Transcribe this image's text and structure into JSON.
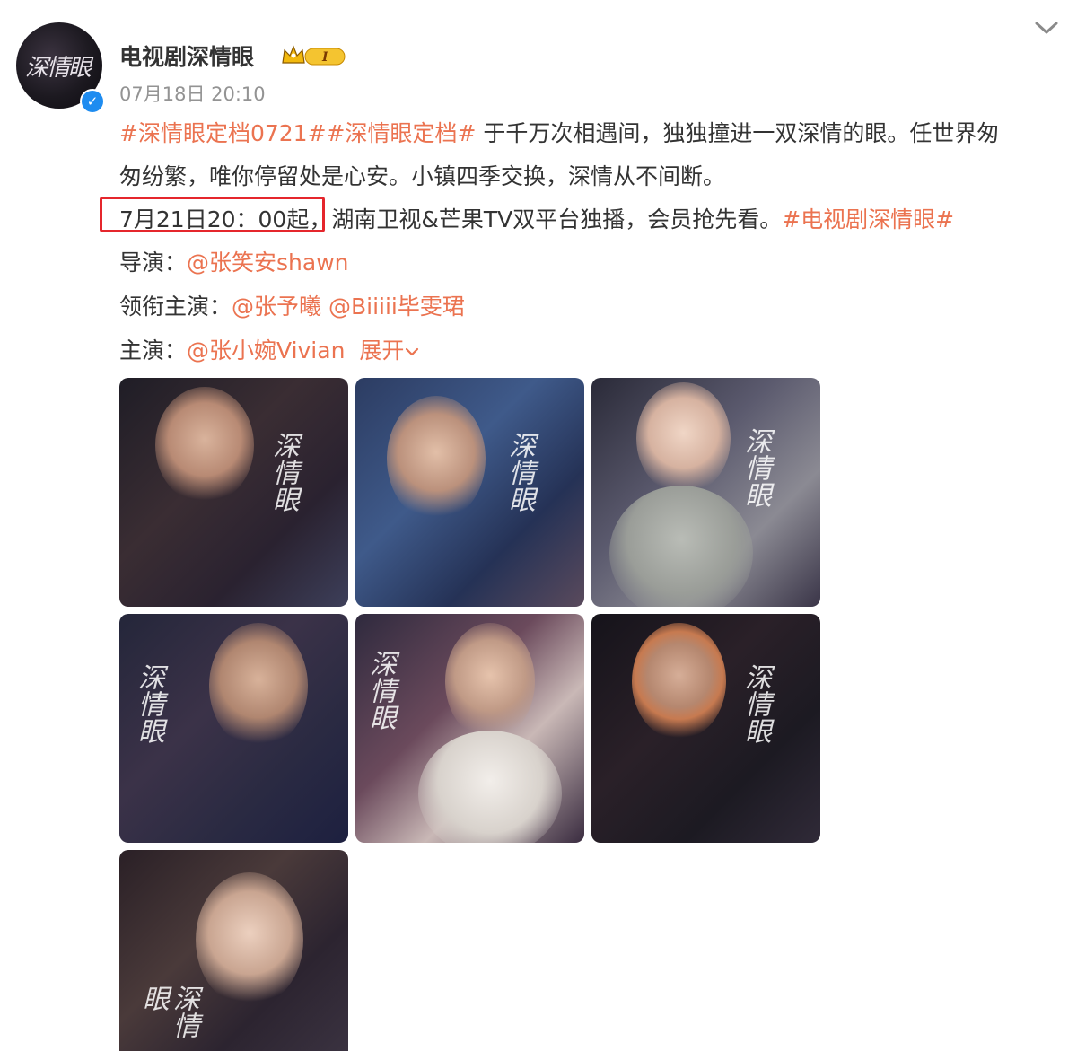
{
  "post": {
    "username": "电视剧深情眼",
    "avatar_text": "深情眼",
    "badge_text": "I",
    "timestamp": "07月18日 20:10",
    "lines": {
      "line1": {
        "tag1": "#深情眼定档0721#",
        "tag2": "#深情眼定档#",
        "text": " 于千万次相遇间，独独撞进一双深情的眼。任世界匆"
      },
      "line2": {
        "text": "匆纷繁，唯你停留处是心安。小镇四季交换，深情从不间断。"
      },
      "line3": {
        "text": "7月21日20：00起，湖南卫视&芒果TV双平台独播，会员抢先看。",
        "tag": "#电视剧深情眼#"
      },
      "line4": {
        "label": "导演：",
        "mention": "@张笑安shawn"
      },
      "line5": {
        "label": "领衔主演：",
        "mention1": "@张予曦",
        "mention2": "@Biiiii毕雯珺"
      },
      "line6": {
        "label": "主演：",
        "mention": "@张小婉Vivian",
        "expand": "展开"
      }
    },
    "photo_title": "深情眼",
    "colors": {
      "accent": "#eb7350",
      "highlight_box": "#e5262c",
      "verified": "#1e8cf0"
    }
  }
}
